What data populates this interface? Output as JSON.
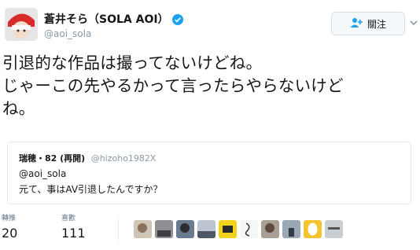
{
  "tweet": {
    "display_name": "蒼井そら（SOLA AOI）",
    "handle": "@aoi_sola",
    "follow_label": "關注",
    "text_lines": [
      "引退的な作品は撮ってないけどね。",
      "じゃーこの先やるかって言ったらやらないけど",
      "ね。"
    ]
  },
  "quote": {
    "name": "瑞穂・82 (再開)",
    "handle": "@hizoho1982X",
    "line1": "@aoi_sola",
    "line2": "元て、事はAV引退したんですか？"
  },
  "stats": {
    "retweets_label": "轉推",
    "retweets_value": "20",
    "likes_label": "喜歡",
    "likes_value": "111"
  },
  "icons": {
    "verified": "verified-badge-icon",
    "follow": "add-user-icon",
    "more": "chevron-down-icon"
  },
  "colors": {
    "verified": "#1da1f2",
    "muted": "#8899a6"
  }
}
